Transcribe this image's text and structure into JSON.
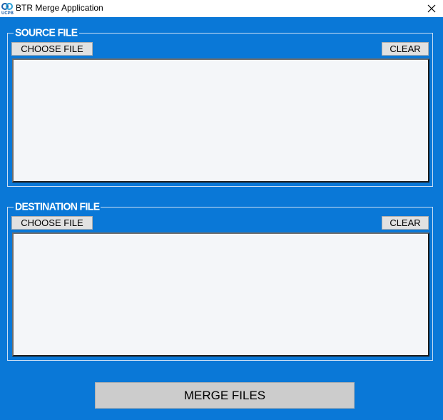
{
  "window": {
    "title": "BTR Merge Application",
    "icon": "ucpb-logo-icon",
    "close_icon": "close-icon"
  },
  "colors": {
    "background": "#0a78d7",
    "button": "#e1e1e1",
    "merge_button": "#cccccc",
    "textbox": "#f4f6f9"
  },
  "source": {
    "legend": "SOURCE FILE",
    "choose_label": "CHOOSE FILE",
    "clear_label": "CLEAR",
    "content": ""
  },
  "destination": {
    "legend": "DESTINATION FILE",
    "choose_label": "CHOOSE FILE",
    "clear_label": "CLEAR",
    "content": ""
  },
  "merge_label": "MERGE FILES"
}
